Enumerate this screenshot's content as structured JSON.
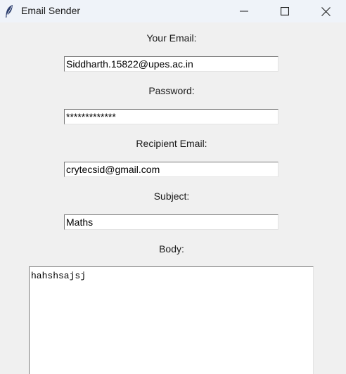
{
  "window": {
    "title": "Email Sender",
    "icon": "feather-icon",
    "controls": [
      "minimize-icon",
      "maximize-icon",
      "close-icon"
    ]
  },
  "form": {
    "your_email": {
      "label": "Your Email:",
      "value": "Siddharth.15822@upes.ac.in"
    },
    "password": {
      "label": "Password:",
      "value": "*************"
    },
    "recipient_email": {
      "label": "Recipient Email:",
      "value": "crytecsid@gmail.com"
    },
    "subject": {
      "label": "Subject:",
      "value": "Maths"
    },
    "body": {
      "label": "Body:",
      "value": "hahshsajsj"
    }
  }
}
